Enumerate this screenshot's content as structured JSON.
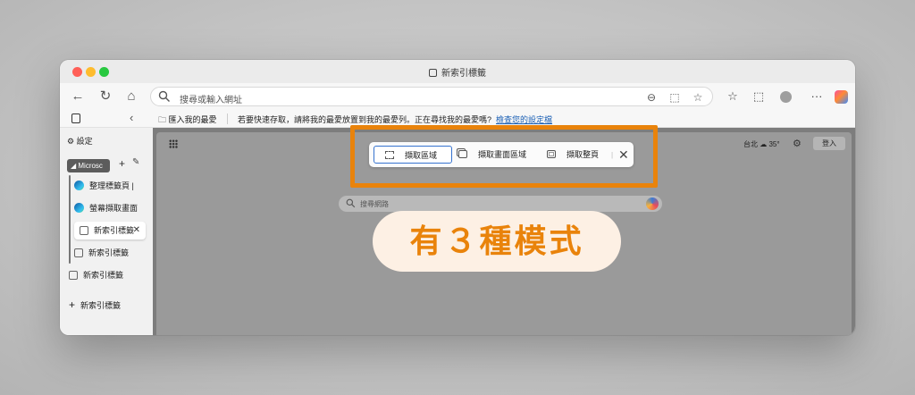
{
  "window": {
    "title": "新索引標籤"
  },
  "toolbar": {
    "address_placeholder": "搜尋或輸入網址"
  },
  "favorites_bar": {
    "import_label": "匯入我的最愛",
    "message": "若要快速存取，請將我的最愛放置到我的最愛列。正在尋找我的最愛嗎?",
    "manage_link": "檢查您的設定檔"
  },
  "sidebar": {
    "settings_label": "設定",
    "group_name": "Microsc",
    "tabs": [
      {
        "label": "整理標籤頁 |"
      },
      {
        "label": "螢幕擷取畫面"
      },
      {
        "label": "新索引標籤"
      },
      {
        "label": "新索引標籤"
      }
    ],
    "extra_tab_label": "新索引標籤",
    "new_tab_label": "新索引標籤"
  },
  "newtab": {
    "weather_location": "台北",
    "weather_temp": "35°",
    "login_label": "登入",
    "search_placeholder": "搜尋網路"
  },
  "capture_toolbar": {
    "buttons": [
      {
        "label": "擷取區域",
        "active": true
      },
      {
        "label": "擷取畫面區域",
        "active": false
      },
      {
        "label": "擷取整頁",
        "active": false
      }
    ]
  },
  "annotation": {
    "callout_text": "有３種模式",
    "color": "#e9830b"
  },
  "colors": {
    "accent_blue": "#3673cf",
    "link": "#1a5fb4"
  }
}
